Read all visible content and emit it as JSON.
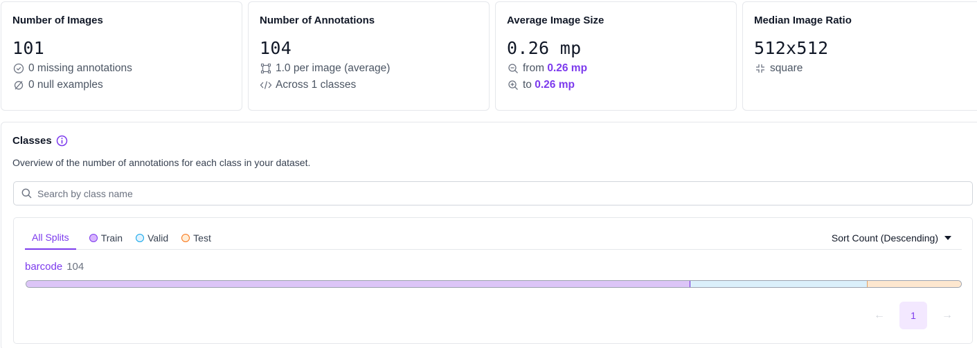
{
  "cards": {
    "images": {
      "title": "Number of Images",
      "value": "101",
      "line1": "0 missing annotations",
      "line2": "0 null examples"
    },
    "annotations": {
      "title": "Number of Annotations",
      "value": "104",
      "line1": "1.0 per image (average)",
      "line2": "Across 1 classes"
    },
    "size": {
      "title": "Average Image Size",
      "value": "0.26 mp",
      "from_label": "from",
      "from_value": "0.26 mp",
      "to_label": "to",
      "to_value": "0.26 mp"
    },
    "ratio": {
      "title": "Median Image Ratio",
      "value": "512x512",
      "line1": "square"
    }
  },
  "classes": {
    "title": "Classes",
    "subtitle": "Overview of the number of annotations for each class in your dataset.",
    "search_placeholder": "Search by class name",
    "tabs": [
      {
        "label": "All Splits",
        "active": true
      },
      {
        "label": "Train",
        "color": "#d8b4fe",
        "border": "#7c3aed"
      },
      {
        "label": "Valid",
        "color": "#bae6fd",
        "border": "#0ea5e9"
      },
      {
        "label": "Test",
        "color": "#fed7aa",
        "border": "#f97316"
      }
    ],
    "sort_label": "Sort Count (Descending)",
    "rows": [
      {
        "name": "barcode",
        "count": "104",
        "split_fractions": {
          "train": 0.71,
          "valid": 0.19,
          "test": 0.1
        }
      }
    ],
    "pagination": {
      "current": "1"
    }
  },
  "colors": {
    "accent": "#7c3aed",
    "train": "#dcc5f7",
    "valid": "#dbf0fb",
    "test": "#fde7cf"
  }
}
